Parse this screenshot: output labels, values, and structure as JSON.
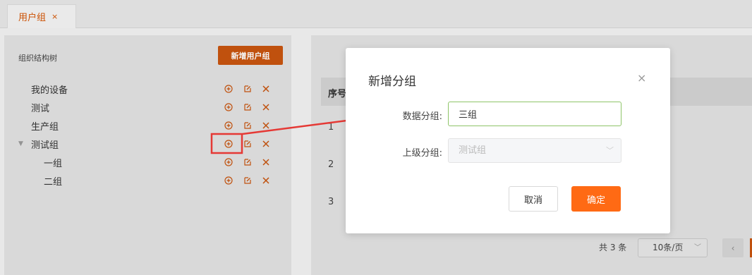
{
  "tabs": [
    {
      "label": "用户组",
      "close": "×"
    }
  ],
  "left": {
    "title": "组织结构树",
    "add_button": "新增用户组",
    "tree": [
      {
        "label": "我的设备",
        "level": 0
      },
      {
        "label": "测试",
        "level": 0
      },
      {
        "label": "生产组",
        "level": 0
      },
      {
        "label": "测试组",
        "level": 0,
        "expanded": true
      },
      {
        "label": "一组",
        "level": 1
      },
      {
        "label": "二组",
        "level": 1
      }
    ],
    "action_icons": [
      "plus-circle-icon",
      "edit-icon",
      "delete-icon"
    ]
  },
  "table": {
    "header_index": "序号",
    "rows": [
      "1",
      "2",
      "3"
    ]
  },
  "pagination": {
    "total": "共 3 条",
    "page_size": "10条/页",
    "prev": "‹"
  },
  "modal": {
    "title": "新增分组",
    "close": "×",
    "name_label": "数据分组:",
    "name_value": "三组",
    "parent_label": "上级分组:",
    "parent_value": "测试组",
    "cancel": "取消",
    "confirm": "确定"
  },
  "colors": {
    "accent": "#ff6a14",
    "accent_dim": "#c8550f",
    "annotation": "#e53935",
    "input_focus": "#8ec468"
  }
}
